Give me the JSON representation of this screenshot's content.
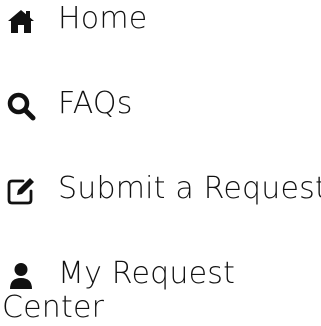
{
  "nav": {
    "items": [
      {
        "label": "Home",
        "icon": "home-icon"
      },
      {
        "label": "FAQs",
        "icon": "search-icon"
      },
      {
        "label": "Submit a Request",
        "icon": "edit-icon"
      },
      {
        "label_line1": "My Request",
        "label_line2": "Center",
        "icon": "user-icon"
      }
    ]
  },
  "colors": {
    "text": "#111111",
    "icon": "#111111",
    "background": "#ffffff"
  }
}
